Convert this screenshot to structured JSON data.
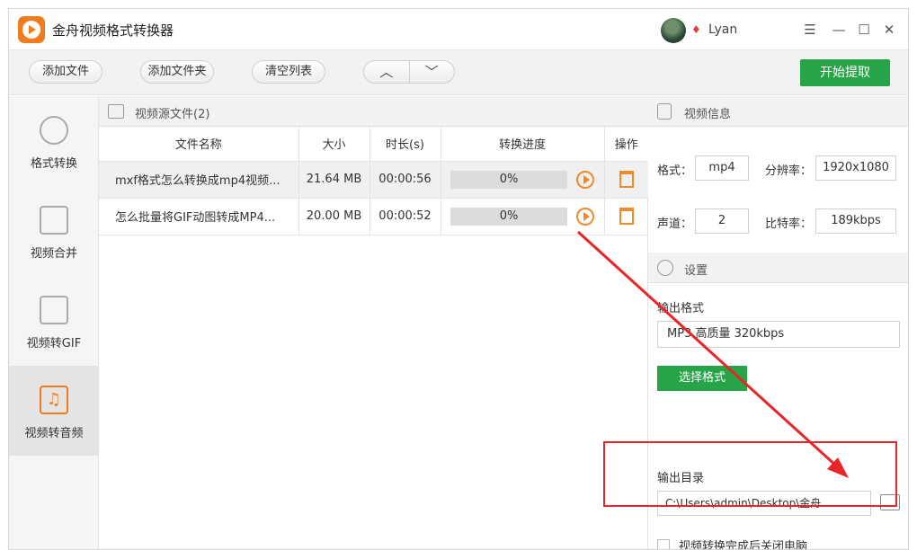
{
  "app": {
    "title": "金舟视频格式转换器",
    "user": "Lyan"
  },
  "window_controls": {
    "menu": "☰",
    "minimize": "—",
    "maximize": "☐",
    "close": "✕"
  },
  "toolbar": {
    "add_file": "添加文件",
    "add_folder": "添加文件夹",
    "clear_list": "清空列表",
    "move_up": "︿",
    "move_down": "﹀",
    "start": "开始提取"
  },
  "sidebar": {
    "items": [
      {
        "label": "格式转换",
        "icon": "format-convert-icon",
        "active": false
      },
      {
        "label": "视频合并",
        "icon": "video-merge-icon",
        "active": false
      },
      {
        "label": "视频转GIF",
        "icon": "video-to-gif-icon",
        "active": false
      },
      {
        "label": "视频转音频",
        "icon": "music-note-icon",
        "active": true
      }
    ]
  },
  "files": {
    "header": "视频源文件(2)",
    "columns": [
      "文件名称",
      "大小",
      "时长(s)",
      "转换进度",
      "操作"
    ],
    "rows": [
      {
        "name": "mxf格式怎么转换成mp4视频...",
        "size": "21.64 MB",
        "duration": "00:00:56",
        "progress": "0%",
        "progress_value": 0
      },
      {
        "name": "怎么批量将GIF动图转成MP4...",
        "size": "20.00 MB",
        "duration": "00:00:52",
        "progress": "0%",
        "progress_value": 0
      }
    ]
  },
  "video_info": {
    "header": "视频信息",
    "format_label": "格式：",
    "format_value": "mp4",
    "resolution_label": "分辨率：",
    "resolution_value": "1920x1080",
    "channels_label": "声道：",
    "channels_value": "2",
    "bitrate_label": "比特率：",
    "bitrate_value": "189kbps"
  },
  "settings": {
    "header": "设置",
    "output_format_label": "输出格式",
    "output_format_value": "MP3 高质量 320kbps",
    "choose_format": "选择格式",
    "output_dir_label": "输出目录",
    "output_dir_value": "C:\\Users\\admin\\Desktop\\金舟",
    "shutdown_label": "视频转换完成后关闭电脑"
  },
  "colors": {
    "accent": "#27a348",
    "orange": "#f07c1e",
    "annotation": "#e8262a"
  }
}
